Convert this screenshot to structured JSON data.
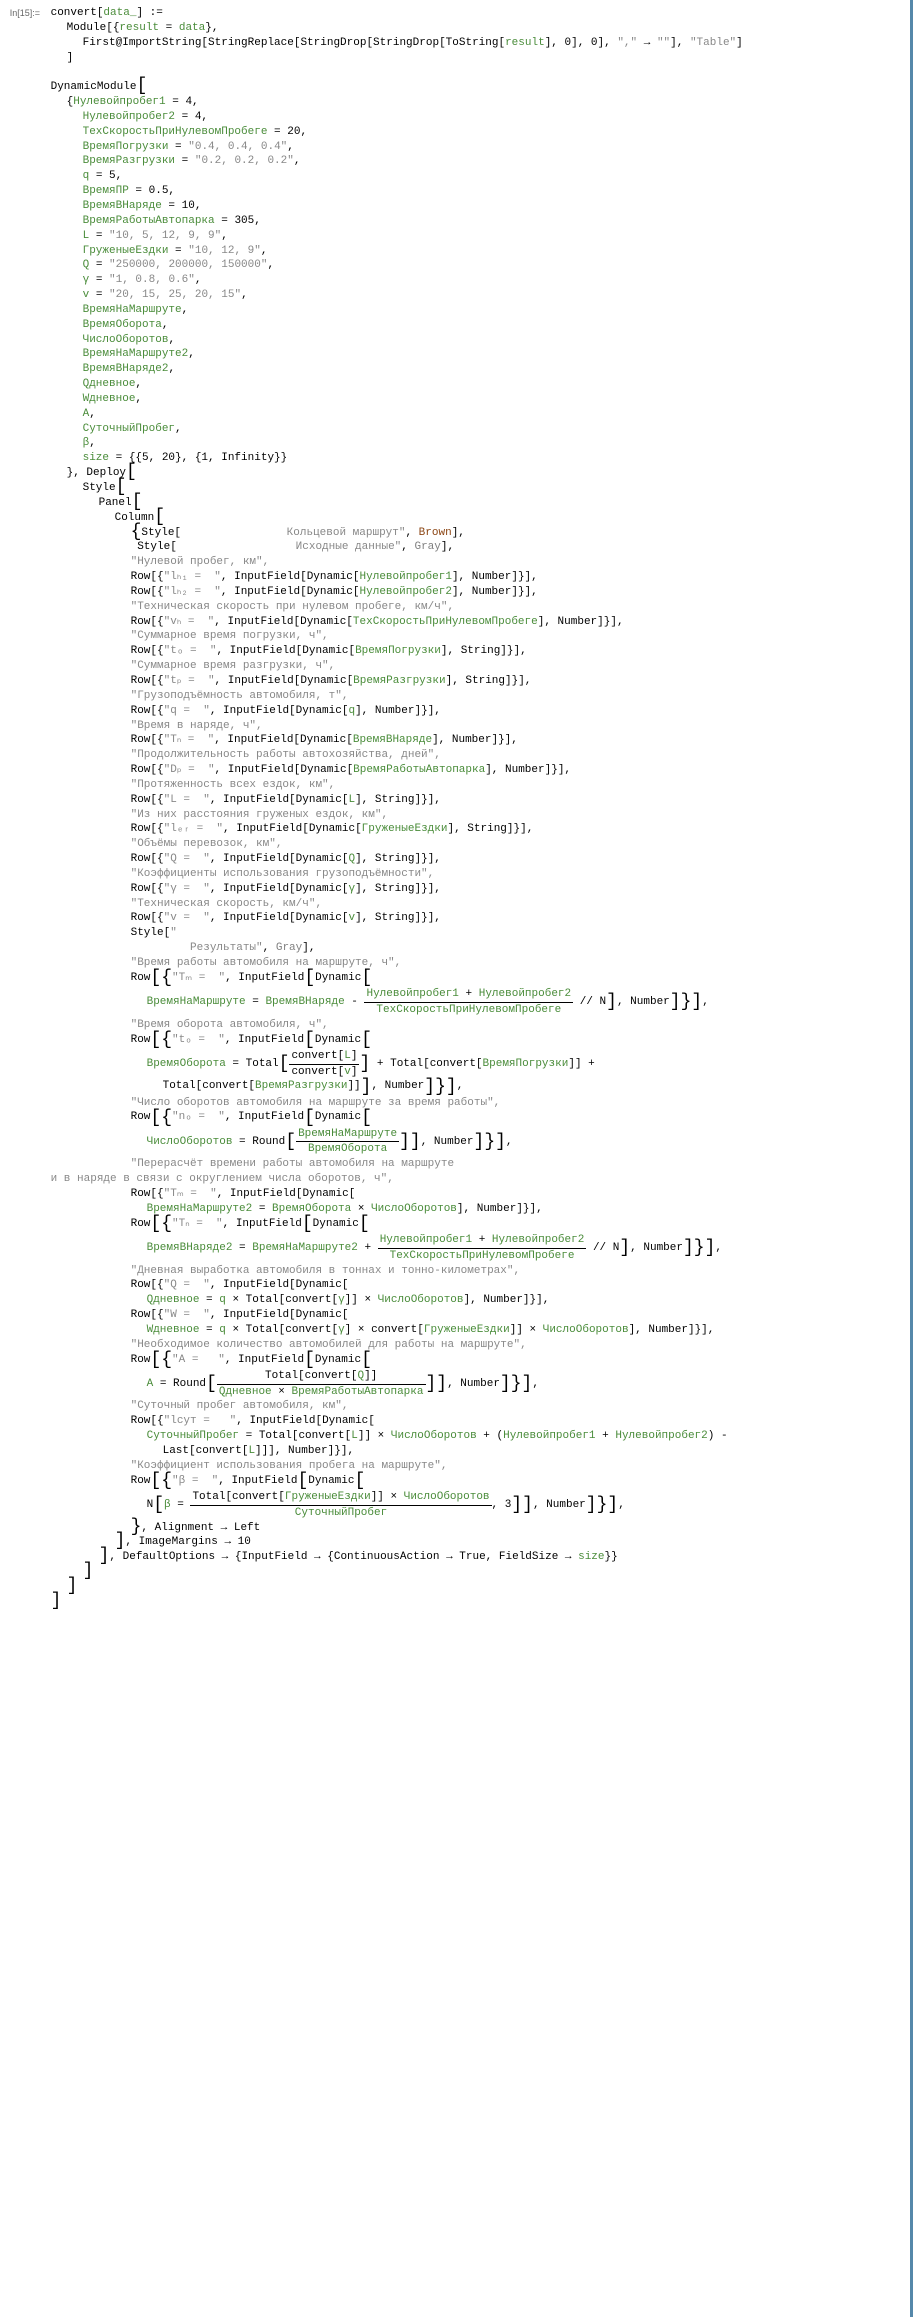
{
  "cell_label": "In[15]:=",
  "header": {
    "l1": "convert[data_] :=",
    "l2": " Module[{result = data},",
    "l3": "  First@ImportString[StringReplace[StringDrop[StringDrop[ToString[result], 0], 0], \",\" → \"\"], \"Table\"]",
    "l4": " ]"
  },
  "dynmod_open": "DynamicModule[",
  "vars": {
    "np1": "Нулевойпробег1 = 4,",
    "np2": "Нулевойпробег2 = 4,",
    "tsk": "ТехСкоростьПриНулевомПробеге = 20,",
    "vpg": "ВремяПогрузки = \"0.4, 0.4, 0.4\",",
    "vrz": "ВремяРазгрузки = \"0.2, 0.2, 0.2\",",
    "q": "q = 5,",
    "vpr": "ВремяПР = 0.5,",
    "vbn": "ВремяВНаряде = 10,",
    "vrap": "ВремяРаботыАвтопарка = 305,",
    "L": "L = \"10, 5, 12, 9, 9\",",
    "ge": "ГруженыеЕздки = \"10, 12, 9\",",
    "Q": "Q = \"250000, 200000, 150000\",",
    "gamma": "γ = \"1, 0.8, 0.6\",",
    "v": "v = \"20, 15, 25, 20, 15\",",
    "vnm": "ВремяНаМаршруте,",
    "vob": "ВремяОборота,",
    "cho": "ЧислоОборотов,",
    "vnm2": "ВремяНаМаршруте2,",
    "vbn2": "ВремяВНаряде2,",
    "qdn": "Qдневное,",
    "wdn": "Wдневное,",
    "A": "A,",
    "sp": "СуточныйПробег,",
    "beta": "β,",
    "size": "size = {{5, 20}, {1, Infinity}}"
  },
  "deploy": "}, Deploy[",
  "style_open": "Style[",
  "panel_open": "Panel[",
  "column_open": "Column[",
  "title1_lead": "{Style[\"",
  "title1": "                Кольцевой маршрут\"",
  "title1_tail": ", Brown],",
  "title2_lead": " Style[\"",
  "title2": "                  Исходные данные\"",
  "title2_tail": ", Gray],",
  "rows": {
    "r_np_label": "\"Нулевой пробег, км\",",
    "r_np1": "Row[{\"lₕ₁ =  \", InputField[Dynamic[Нулевойпробег1], Number]}],",
    "r_np2": "Row[{\"lₕ₂ =  \", InputField[Dynamic[Нулевойпробег2], Number]}],",
    "r_tsk_label": "\"Техническая скорость при нулевом пробеге, км/ч\",",
    "r_tsk": "Row[{\"vₕ =  \", InputField[Dynamic[ТехСкоростьПриНулевомПробеге], Number]}],",
    "r_vpg_label": "\"Суммарное время погрузки, ч\",",
    "r_vpg": "Row[{\"tₒ =  \", InputField[Dynamic[ВремяПогрузки], String]}],",
    "r_vrz_label": "\"Суммарное время разгрузки, ч\",",
    "r_vrz": "Row[{\"tₚ =  \", InputField[Dynamic[ВремяРазгрузки], String]}],",
    "r_q_label": "\"Грузоподъёмность автомобиля, т\",",
    "r_q": "Row[{\"q =  \", InputField[Dynamic[q], Number]}],",
    "r_tn_label": "\"Время в наряде, ч\",",
    "r_tn": "Row[{\"Tₙ =  \", InputField[Dynamic[ВремяВНаряде], Number]}],",
    "r_dp_label": "\"Продолжительность работы автохозяйства, дней\",",
    "r_dp": "Row[{\"Dₚ =  \", InputField[Dynamic[ВремяРаботыАвтопарка], Number]}],",
    "r_L_label": "\"Протяженность всех ездок, км\",",
    "r_L": "Row[{\"L =  \", InputField[Dynamic[L], String]}],",
    "r_ge_label": "\"Из них расстояния груженых ездок, км\",",
    "r_ge": "Row[{\"lₑᵣ =  \", InputField[Dynamic[ГруженыеЕздки], String]}],",
    "r_Q_label": "\"Объёмы перевозок, км\",",
    "r_Q": "Row[{\"Q =  \", InputField[Dynamic[Q], String]}],",
    "r_gamma_label": "\"Коэффициенты использования грузоподъёмности\",",
    "r_gamma": "Row[{\"γ =  \", InputField[Dynamic[γ], String]}],",
    "r_v_label": "\"Техническая скорость, км/ч\",",
    "r_v": "Row[{\"v =  \", InputField[Dynamic[v], String]}],",
    "res_header_lead": "Style[\"",
    "res_header": "         Результаты\"",
    "res_header_tail": ", Gray],",
    "r_tm_label": "\"Время работы автомобиля на маршруте, ч\",",
    "r_tm_open": "Row[{\"Tₘ =  \", InputField[Dynamic[",
    "r_tm_expr_l": "ВремяНаМаршруте = ВремяВНаряде - ",
    "r_tm_frac_top": "Нулевойпробег1 + Нулевойпробег2",
    "r_tm_frac_bot": "ТехСкоростьПриНулевомПробеге",
    "r_tm_expr_r": " // N], Number]}],",
    "r_to_label": "\"Время оборота автомобиля, ч\",",
    "r_to_open": "Row[{\"tₒ =  \", InputField[Dynamic[",
    "r_to_l": "ВремяОборота = Total[",
    "r_to_frac_top": "convert[L]",
    "r_to_frac_bot": "convert[v]",
    "r_to_m": "] + Total[convert[ВремяПогрузки]] +",
    "r_to_tail": "    Total[convert[ВремяРазгрузки]]], Number]}],",
    "r_no_label": "\"Число оборотов автомобиля на маршруте за время работы\",",
    "r_no_open": "Row[{\"nₒ =  \", InputField[Dynamic[",
    "r_no_l": "ЧислоОборотов = Round[",
    "r_no_frac_top": "ВремяНаМаршруте",
    "r_no_frac_bot": "ВремяОборота",
    "r_no_tail": "]], Number]}],",
    "r_tm2_label1": "\"Перерасчёт времени работы автомобиля на маршруте",
    "r_tm2_label2": "и в наряде в связи с округлением числа оборотов, ч\",",
    "r_tm2": "Row[{\"Tₘ =  \", InputField[Dynamic[",
    "r_tm2_body": "ВремяНаМаршруте2 = ВремяОборота × ЧислоОборотов], Number]}],",
    "r_tn2_open": "Row[{\"Tₙ =  \", InputField[Dynamic[",
    "r_tn2_l": "ВремяВНаряде2 = ВремяНаМаршруте2 + ",
    "r_tn2_frac_top": "Нулевойпробег1 + Нулевойпробег2",
    "r_tn2_frac_bot": "ТехСкоростьПриНулевомПробеге",
    "r_tn2_tail": " // N], Number]}],",
    "r_qd_label": "\"Дневная выработка автомобиля в тоннах и тонно-километрах\",",
    "r_qd": "Row[{\"Q =  \", InputField[Dynamic[",
    "r_qd_body": "Qдневное = q × Total[convert[γ]] × ЧислоОборотов], Number]}],",
    "r_wd": "Row[{\"W =  \", InputField[Dynamic[",
    "r_wd_body": "Wдневное = q × Total[convert[γ] × convert[ГруженыеЕздки]] × ЧислоОборотов], Number]}],",
    "r_A_label": "\"Необходимое количество автомобилей для работы на маршруте\",",
    "r_A_open": "Row[{\"A =   \", InputField[Dynamic[",
    "r_A_l": "A = Round[",
    "r_A_frac_top": "Total[convert[Q]]",
    "r_A_frac_bot": "Qдневное × ВремяРаботыАвтопарка",
    "r_A_tail": "]], Number]}],",
    "r_sp_label": "\"Суточный пробег автомобиля, км\",",
    "r_sp": "Row[{\"lсут =   \", InputField[Dynamic[",
    "r_sp_body": "СуточныйПробег = Total[convert[L]] × ЧислоОборотов + (Нулевойпробег1 + Нулевойпробег2) -",
    "r_sp_body2": "Last[convert[L]]], Number]}],",
    "r_beta_label": "\"Коэффициент использования пробега на маршруте\",",
    "r_beta_open": "Row[{\"β =  \", InputField[Dynamic[",
    "r_beta_l": "N[β = ",
    "r_beta_frac_top": "Total[convert[ГруженыеЕздки]] × ЧислоОборотов",
    "r_beta_frac_bot": "СуточныйПробег",
    "r_beta_tail": ", 3]], Number]}],"
  },
  "closing": {
    "align": "}, Alignment → Left",
    "img": "], ImageMargins → 10",
    "defopt": "], DefaultOptions → {InputField → {ContinuousAction → True, FieldSize → size}}",
    "c1": "]",
    "c2": "]",
    "c3": "]"
  }
}
